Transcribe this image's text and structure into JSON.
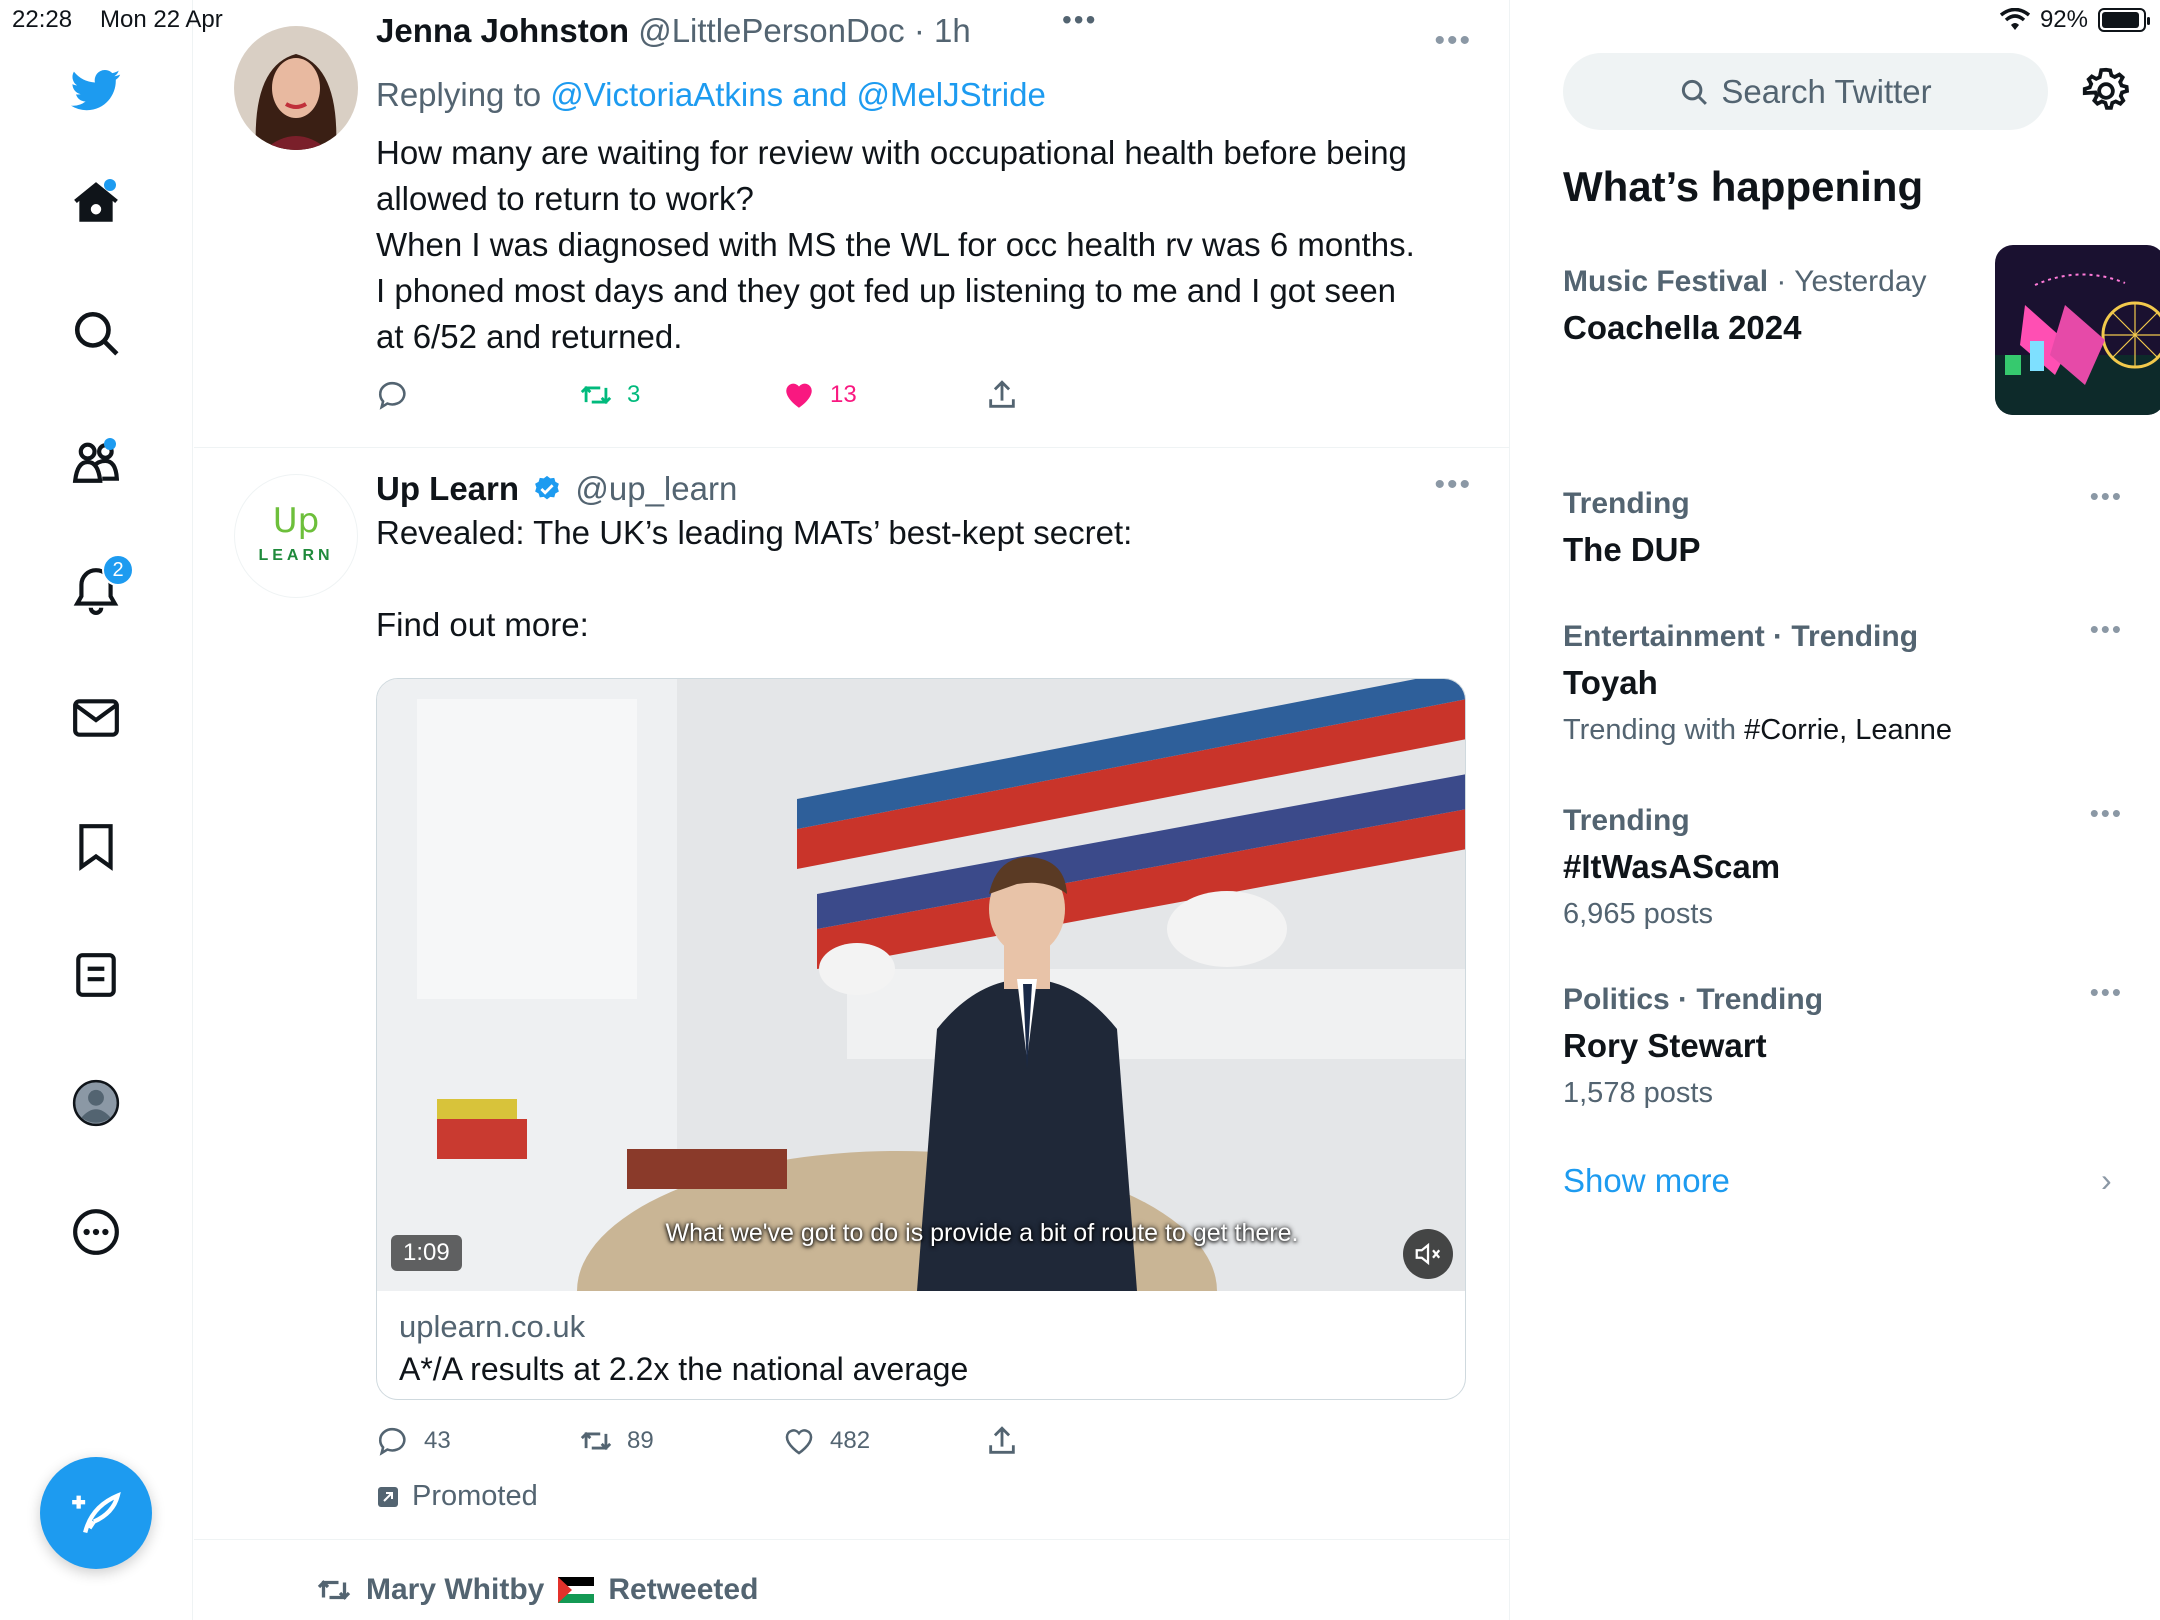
{
  "status_bar": {
    "time": "22:28",
    "date": "Mon 22 Apr",
    "battery": "92%"
  },
  "sidebar": {
    "items": [
      {
        "icon": "twitter-bird-icon"
      },
      {
        "icon": "home-icon",
        "dot": true
      },
      {
        "icon": "search-icon"
      },
      {
        "icon": "communities-icon",
        "dot": true
      },
      {
        "icon": "notifications-icon",
        "badge": "2"
      },
      {
        "icon": "messages-icon"
      },
      {
        "icon": "bookmarks-icon"
      },
      {
        "icon": "lists-icon"
      },
      {
        "icon": "profile-icon"
      },
      {
        "icon": "more-icon"
      }
    ],
    "compose_icon": "compose-icon",
    "accent": "#1d9bf0"
  },
  "timeline": {
    "tweet1": {
      "name": "Jenna Johnston",
      "handle": "@LittlePersonDoc · 1h",
      "replying_prefix": "Replying to ",
      "replying_to": "@VictoriaAtkins and @MelJStride",
      "lines": [
        "How many are waiting for review with occupational health before being",
        "allowed to return to work?",
        "When I was diagnosed with MS the WL for occ health rv was 6 months.",
        "I phoned most days and they got fed up listening to me and I got seen",
        "at 6/52 and returned."
      ],
      "retweets": "3",
      "likes": "13",
      "like_color": "#f91880",
      "retweet_color": "#00ba7c"
    },
    "tweet2": {
      "name": "Up Learn",
      "handle": "@up_learn",
      "avatar_text_top": "Up",
      "avatar_text_bottom": "LEARN",
      "text_line1": "Revealed: The UK’s leading MATs’ best-kept secret:",
      "text_line2": "Find out more:",
      "video_duration": "1:09",
      "video_caption": "What we've got to do is provide a bit of route to get there.",
      "card_domain": "uplearn.co.uk",
      "card_title": "A*/A results at 2.2x the national average",
      "replies": "43",
      "retweets": "89",
      "likes": "482",
      "promoted": "Promoted"
    },
    "retweet_banner": {
      "user": "Mary Whitby",
      "label": "Retweeted"
    }
  },
  "right": {
    "search_placeholder": "Search Twitter",
    "section_title": "What’s happening",
    "trends": [
      {
        "category": "Music Festival",
        "time": " · Yesterday",
        "name": "Coachella 2024"
      },
      {
        "category": "Trending",
        "name": "The DUP"
      },
      {
        "category": "Entertainment · Trending",
        "name": "Toyah",
        "sub_prefix": "Trending with ",
        "sub_tags": "#Corrie, Leanne"
      },
      {
        "category": "Trending",
        "name": "#ItWasAScam",
        "sub": "6,965 posts"
      },
      {
        "category": "Politics · Trending",
        "name": "Rory Stewart",
        "sub": "1,578 posts"
      }
    ],
    "show_more": "Show more"
  }
}
